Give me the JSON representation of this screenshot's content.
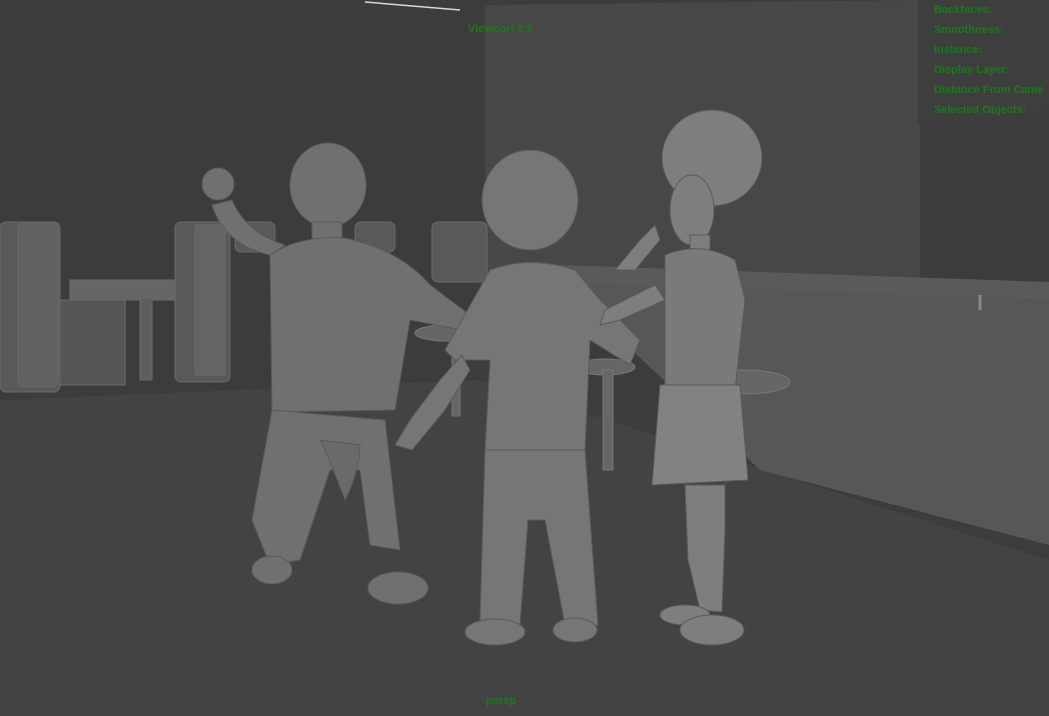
{
  "viewport": {
    "renderer_label": "Viewport 2.0",
    "camera_label": "persp",
    "hud": [
      "Backfaces:",
      "Smoothness:",
      "Instance:",
      "Display Layer:",
      "Distance From Came",
      "Selected Objects:"
    ]
  },
  "colors": {
    "background": "#3a3a3a",
    "hud_text": "#1a7a1a",
    "model_shading": "#7a7a7a"
  }
}
